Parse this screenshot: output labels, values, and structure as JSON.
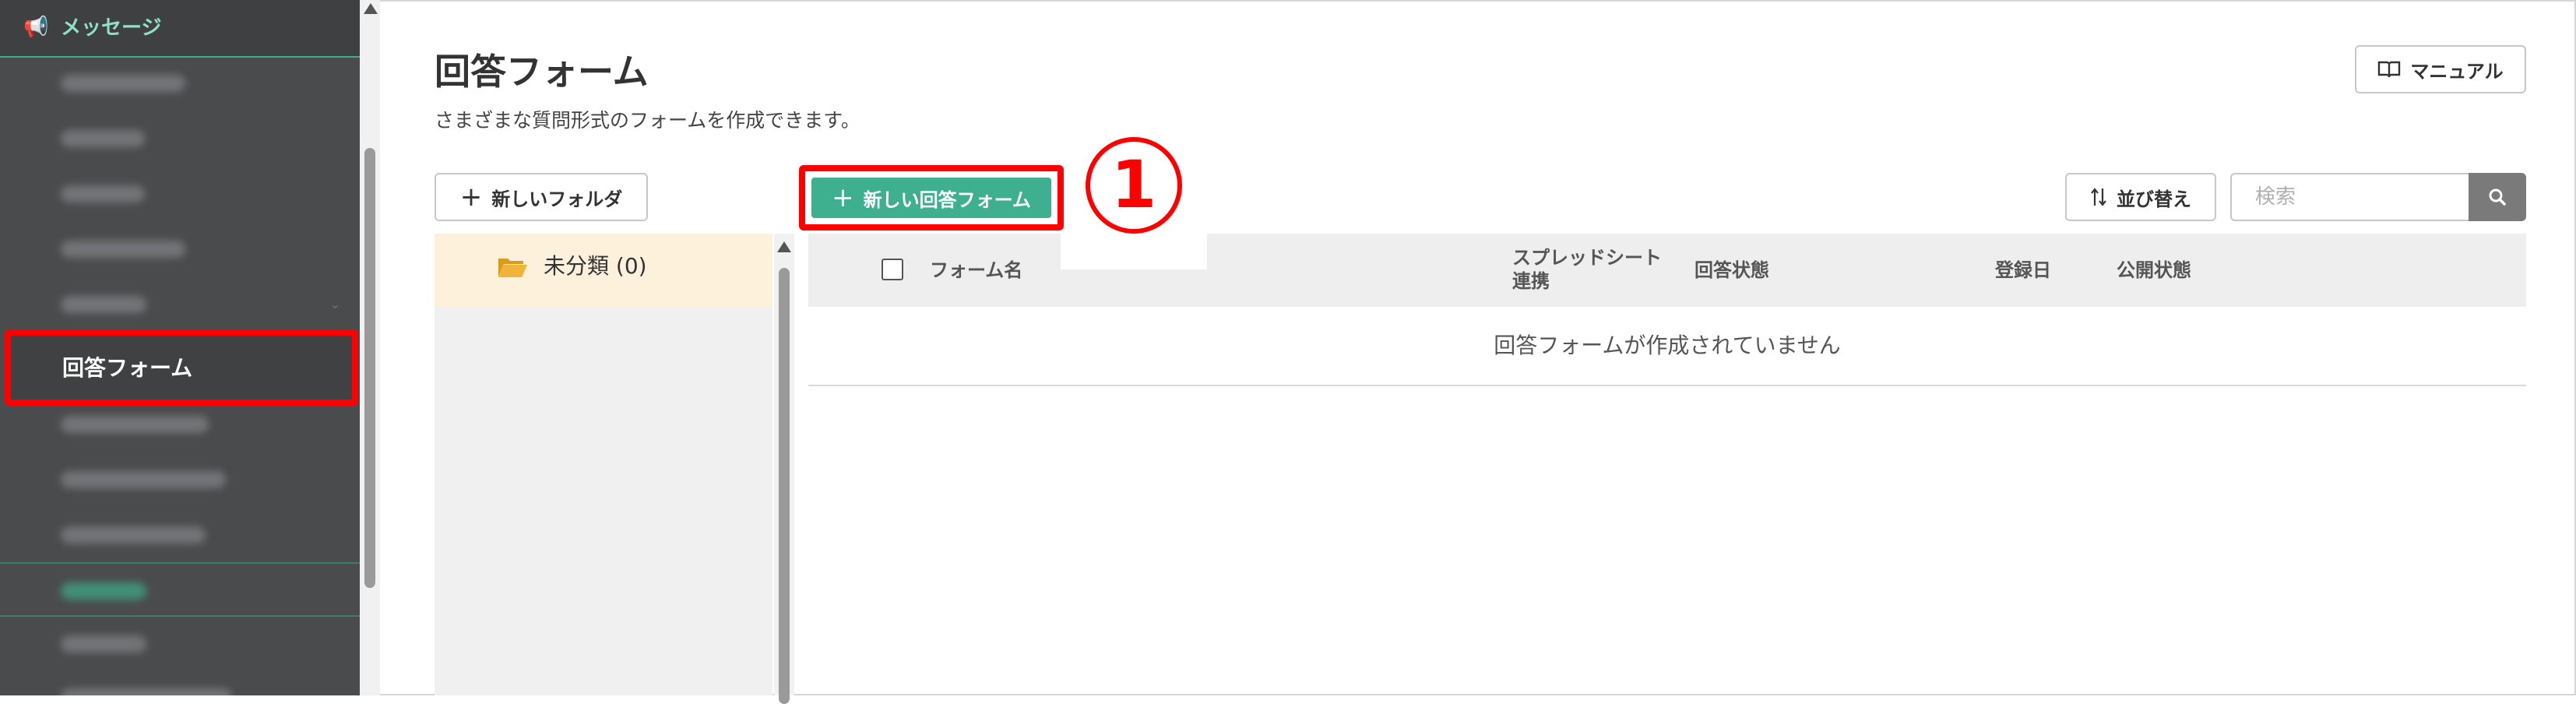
{
  "sidebar": {
    "header": {
      "label": "メッセージ",
      "icon": "megaphone-icon"
    },
    "active_item": {
      "label": "回答フォーム"
    }
  },
  "page": {
    "title": "回答フォーム",
    "subtitle": "さまざまな質問形式のフォームを作成できます。"
  },
  "toolbar": {
    "manual_label": "マニュアル",
    "new_folder_label": "新しいフォルダ",
    "new_form_label": "新しい回答フォーム",
    "sort_label": "並び替え",
    "search_placeholder": "検索"
  },
  "annotation": {
    "step": "1"
  },
  "folders": [
    {
      "label": "未分類 (0)"
    }
  ],
  "table": {
    "columns": {
      "name": "フォーム名",
      "sheet": "スプレッドシート連携",
      "status": "回答状態",
      "date": "登録日",
      "public": "公開状態"
    },
    "empty_message": "回答フォームが作成されていません"
  },
  "colors": {
    "accent": "#3fb08f",
    "highlight": "#ff0000",
    "sidebar_bg": "#4a4b4d",
    "folder_selected_bg": "#fdf1dc"
  }
}
